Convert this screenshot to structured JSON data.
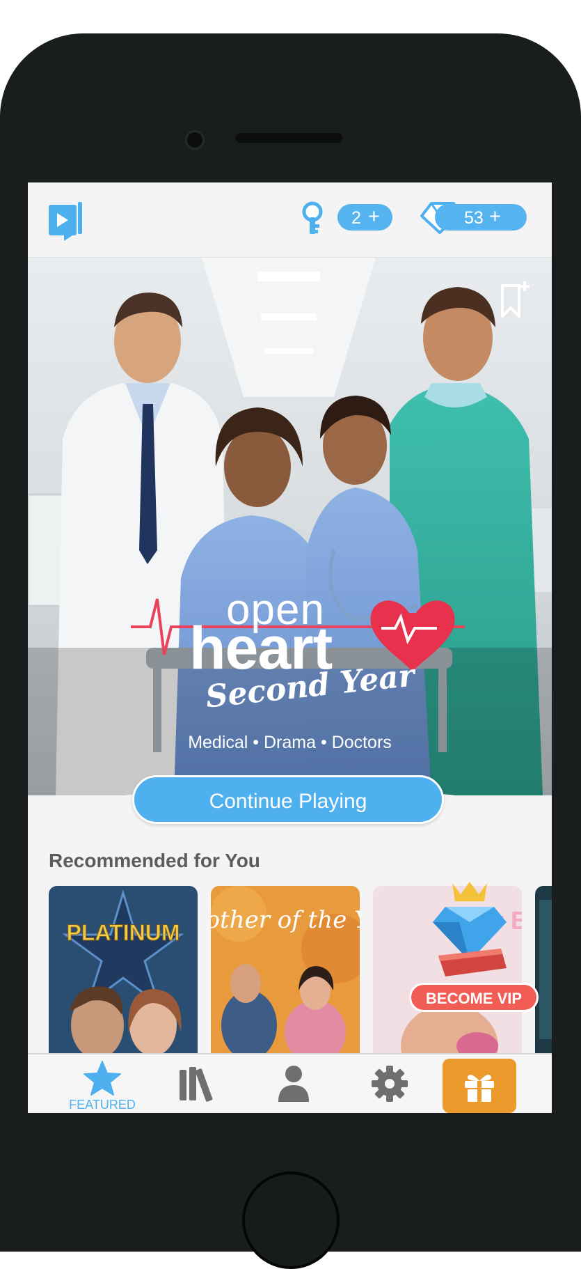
{
  "header": {
    "keys_count": "2",
    "keys_plus": "+",
    "gems_count": "53",
    "gems_plus": "+"
  },
  "hero": {
    "title_line1": "open",
    "title_line2": "heart",
    "title_line3": "Second Year",
    "genres": "Medical • Drama • Doctors",
    "cta_label": "Continue Playing"
  },
  "recommended": {
    "title": "Recommended for You",
    "cards": [
      {
        "title": "PLATINUM"
      },
      {
        "title": "Mother of the Year"
      },
      {
        "title": "Baby Bump"
      }
    ],
    "vip_badge": "BECOME VIP"
  },
  "tabbar": {
    "featured_label": "FEATURED"
  },
  "colors": {
    "accent": "#4fb0ef",
    "gift": "#ec9a2b",
    "vip": "#f15c54"
  }
}
